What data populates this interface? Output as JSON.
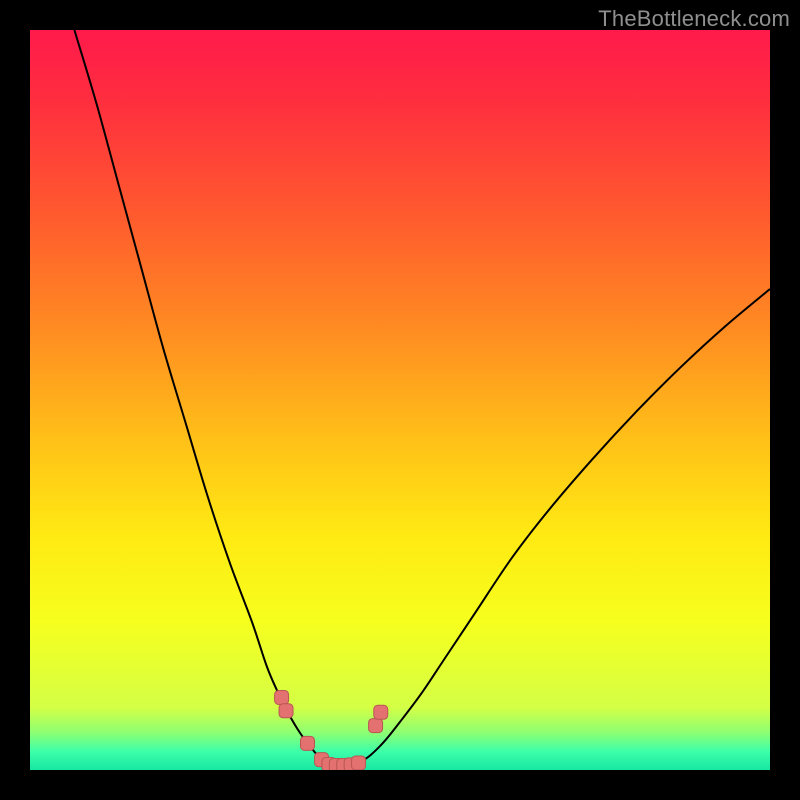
{
  "watermark": "TheBottleneck.com",
  "colors": {
    "frame": "#000000",
    "curve": "#000000",
    "marker_fill": "#e2716f",
    "marker_stroke": "#b95653",
    "gradient_stops": [
      {
        "offset": 0.0,
        "color": "#ff1a4b"
      },
      {
        "offset": 0.1,
        "color": "#ff2f3e"
      },
      {
        "offset": 0.25,
        "color": "#ff5a2e"
      },
      {
        "offset": 0.4,
        "color": "#ff8a22"
      },
      {
        "offset": 0.55,
        "color": "#ffbf18"
      },
      {
        "offset": 0.68,
        "color": "#ffe913"
      },
      {
        "offset": 0.8,
        "color": "#f6ff1e"
      },
      {
        "offset": 0.915,
        "color": "#d4ff45"
      },
      {
        "offset": 0.95,
        "color": "#8cff74"
      },
      {
        "offset": 0.975,
        "color": "#3dffa9"
      },
      {
        "offset": 1.0,
        "color": "#17e6a3"
      }
    ]
  },
  "chart_data": {
    "type": "line",
    "title": "",
    "xlabel": "",
    "ylabel": "",
    "xlim": [
      0,
      100
    ],
    "ylim": [
      0,
      100
    ],
    "left_curve": {
      "x": [
        6,
        9,
        12,
        15,
        18,
        21,
        24,
        27,
        30,
        32,
        33.5,
        35,
        36.5,
        38,
        39,
        39.8
      ],
      "y": [
        100,
        90,
        79,
        68,
        57,
        47,
        37,
        28,
        20,
        14,
        10.5,
        7.5,
        5,
        3,
        1.8,
        1.0
      ]
    },
    "right_curve": {
      "x": [
        44.5,
        46,
        48,
        50,
        53,
        56,
        60,
        65,
        70,
        76,
        82,
        88,
        94,
        100
      ],
      "y": [
        1.0,
        2.0,
        4.0,
        6.5,
        10.5,
        15,
        21,
        28.5,
        35,
        42,
        48.5,
        54.5,
        60,
        65
      ]
    },
    "valley_floor": {
      "x": [
        39.8,
        41,
        42.2,
        43.4,
        44.5
      ],
      "y": [
        1.0,
        0.7,
        0.6,
        0.7,
        1.0
      ]
    },
    "markers": [
      {
        "x": 34.0,
        "y": 9.8
      },
      {
        "x": 34.6,
        "y": 8.0
      },
      {
        "x": 37.5,
        "y": 3.6
      },
      {
        "x": 39.4,
        "y": 1.4
      },
      {
        "x": 40.4,
        "y": 0.75
      },
      {
        "x": 41.4,
        "y": 0.6
      },
      {
        "x": 42.4,
        "y": 0.6
      },
      {
        "x": 43.4,
        "y": 0.7
      },
      {
        "x": 44.4,
        "y": 0.95
      },
      {
        "x": 46.7,
        "y": 6.0
      },
      {
        "x": 47.4,
        "y": 7.8
      }
    ]
  }
}
